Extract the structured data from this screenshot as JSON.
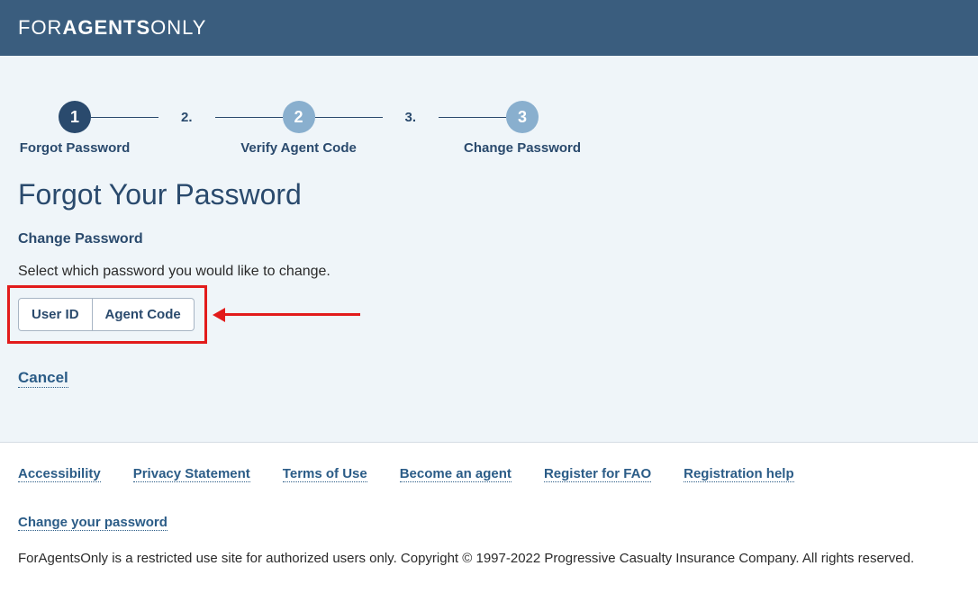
{
  "logo": {
    "part1": "FOR",
    "part2": "AGENTS",
    "part3": "ONLY"
  },
  "stepper": {
    "steps": [
      {
        "num": "1",
        "label": "Forgot Password"
      },
      {
        "num": "2.",
        "sep": true
      },
      {
        "circle2": "2",
        "label2": "Verify Agent Code"
      },
      {
        "num": "3.",
        "sep": true
      },
      {
        "circle3": "3",
        "label3": "Change Password"
      }
    ],
    "step1_num": "1",
    "step1_label": "Forgot Password",
    "sep2": "2.",
    "step2_num": "2",
    "step2_label": "Verify Agent Code",
    "sep3": "3.",
    "step3_num": "3",
    "step3_label": "Change Password"
  },
  "page": {
    "title": "Forgot Your Password",
    "subtitle": "Change Password",
    "description": "Select which password you would like to change."
  },
  "buttons": {
    "user_id": "User ID",
    "agent_code": "Agent Code"
  },
  "links": {
    "cancel": "Cancel"
  },
  "footer": {
    "links": {
      "accessibility": "Accessibility",
      "privacy": "Privacy Statement",
      "terms": "Terms of Use",
      "become": "Become an agent",
      "register": "Register for FAO",
      "help": "Registration help",
      "change": "Change your password"
    },
    "copyright": "ForAgentsOnly is a restricted use site for authorized users only. Copyright © 1997-2022 Progressive Casualty Insurance Company. All rights reserved."
  }
}
